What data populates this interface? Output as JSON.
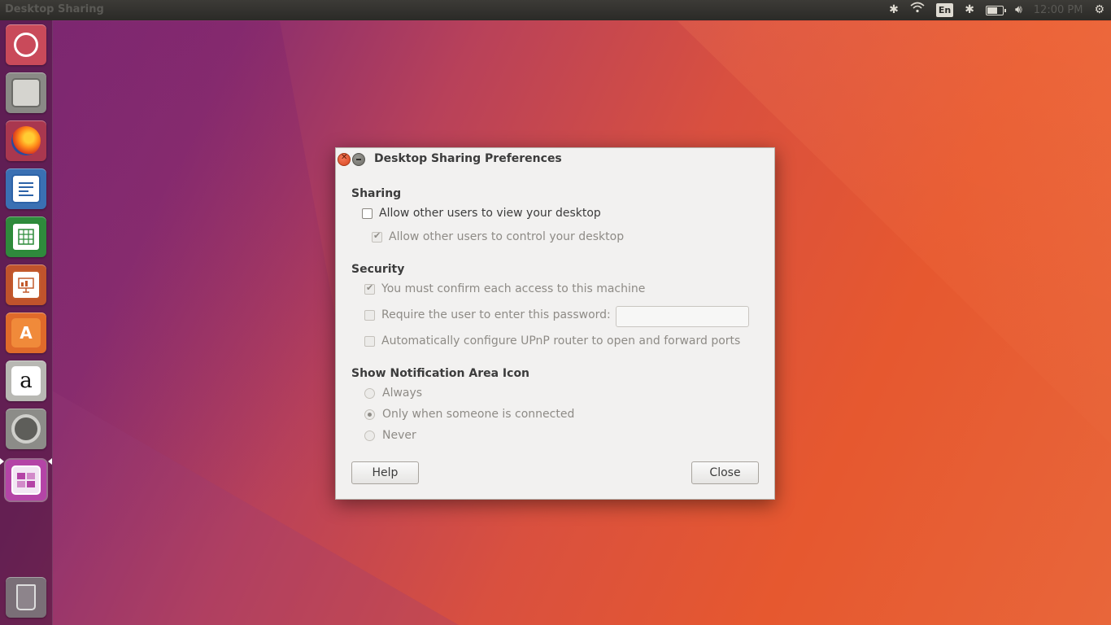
{
  "top_panel": {
    "app_title": "Desktop Sharing",
    "language_indicator": "En",
    "clock": "12:00 PM"
  },
  "launcher": {
    "items": [
      {
        "name": "Ubuntu Dash",
        "icon": "ubuntu-icon"
      },
      {
        "name": "Files",
        "icon": "files-icon"
      },
      {
        "name": "Firefox Web Browser",
        "icon": "firefox-icon"
      },
      {
        "name": "LibreOffice Writer",
        "icon": "writer-icon"
      },
      {
        "name": "LibreOffice Calc",
        "icon": "calc-icon"
      },
      {
        "name": "LibreOffice Impress",
        "icon": "impress-icon"
      },
      {
        "name": "Ubuntu Software",
        "icon": "software-icon",
        "glyph": "A"
      },
      {
        "name": "Amazon",
        "icon": "amazon-icon",
        "glyph": "a"
      },
      {
        "name": "System Settings",
        "icon": "settings-icon"
      },
      {
        "name": "Desktop Sharing",
        "icon": "desktop-sharing-icon"
      },
      {
        "name": "Trash",
        "icon": "trash-icon"
      }
    ]
  },
  "dialog": {
    "title": "Desktop Sharing Preferences",
    "sharing": {
      "heading": "Sharing",
      "allow_view": {
        "label": "Allow other users to view your desktop",
        "checked": false,
        "enabled": true
      },
      "allow_control": {
        "label": "Allow other users to control your desktop",
        "checked": true,
        "enabled": false
      }
    },
    "security": {
      "heading": "Security",
      "confirm_access": {
        "label": "You must confirm each access to this machine",
        "checked": true,
        "enabled": false
      },
      "require_password": {
        "label": "Require the user to enter this password:",
        "checked": false,
        "enabled": false
      },
      "password_value": "",
      "upnp": {
        "label": "Automatically configure UPnP router to open and forward ports",
        "checked": false,
        "enabled": false
      }
    },
    "notification": {
      "heading": "Show Notification Area Icon",
      "options": [
        {
          "label": "Always",
          "selected": false
        },
        {
          "label": "Only when someone is connected",
          "selected": true
        },
        {
          "label": "Never",
          "selected": false
        }
      ]
    },
    "buttons": {
      "help": "Help",
      "close": "Close"
    }
  },
  "colors": {
    "accent": "#e95420",
    "launcher_bg": "#46143c",
    "dialog_bg": "#f2f1f0"
  }
}
